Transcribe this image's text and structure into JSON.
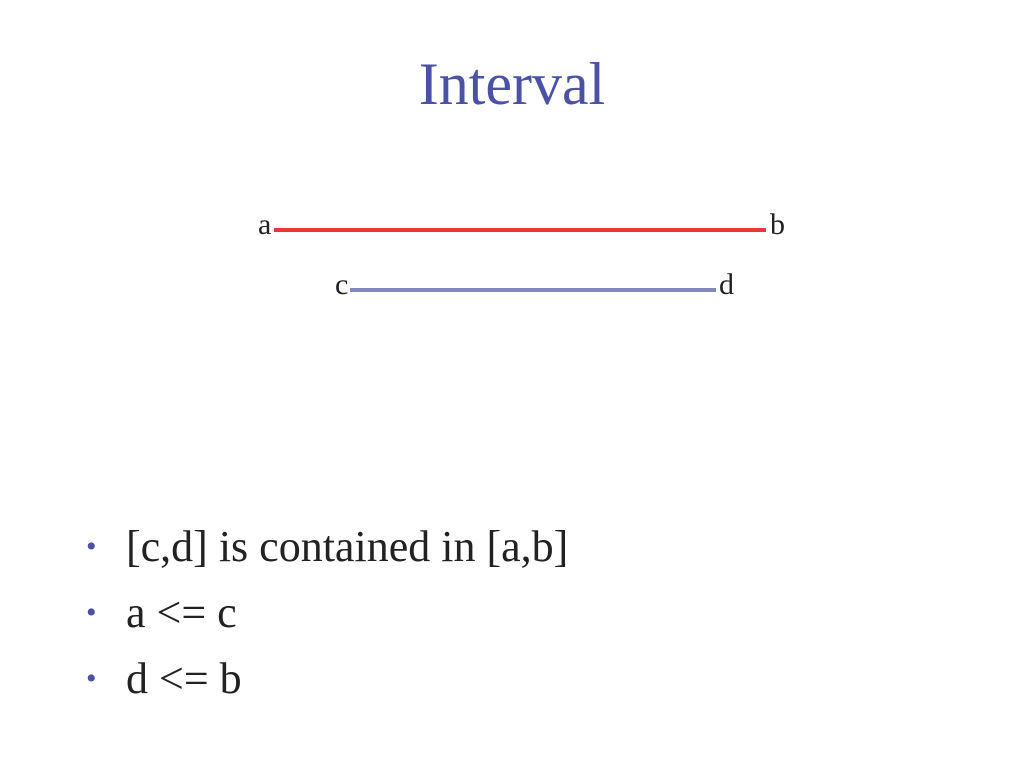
{
  "slide": {
    "title": "Interval"
  },
  "diagram": {
    "interval_outer": {
      "start_label": "a",
      "end_label": "b",
      "color": "#e8393a"
    },
    "interval_inner": {
      "start_label": "c",
      "end_label": "d",
      "color": "#8488c0"
    }
  },
  "bullets": {
    "marker": "•",
    "marker_color": "#4b52a6",
    "items": [
      "[c,d] is contained in [a,b]",
      "a <= c",
      "d <= b"
    ]
  }
}
